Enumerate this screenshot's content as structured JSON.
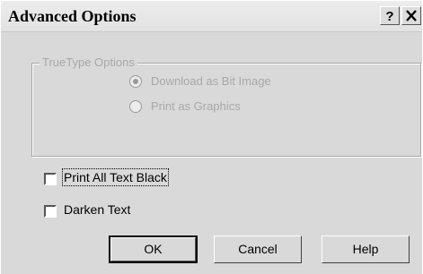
{
  "window": {
    "title": "Advanced Options"
  },
  "titlebar_buttons": [
    {
      "name": "help-icon",
      "glyph": "?"
    },
    {
      "name": "close-icon",
      "glyph": "X"
    }
  ],
  "truetype": {
    "legend": "TrueType Options",
    "options": [
      {
        "label": "Download as Bit Image",
        "selected": true,
        "enabled": false
      },
      {
        "label": "Print as Graphics",
        "selected": false,
        "enabled": false
      }
    ]
  },
  "checkboxes": [
    {
      "label": "Print All Text Black",
      "checked": false
    },
    {
      "label": "Darken Text",
      "checked": false
    }
  ],
  "buttons": {
    "ok": "OK",
    "cancel": "Cancel",
    "help": "Help"
  }
}
